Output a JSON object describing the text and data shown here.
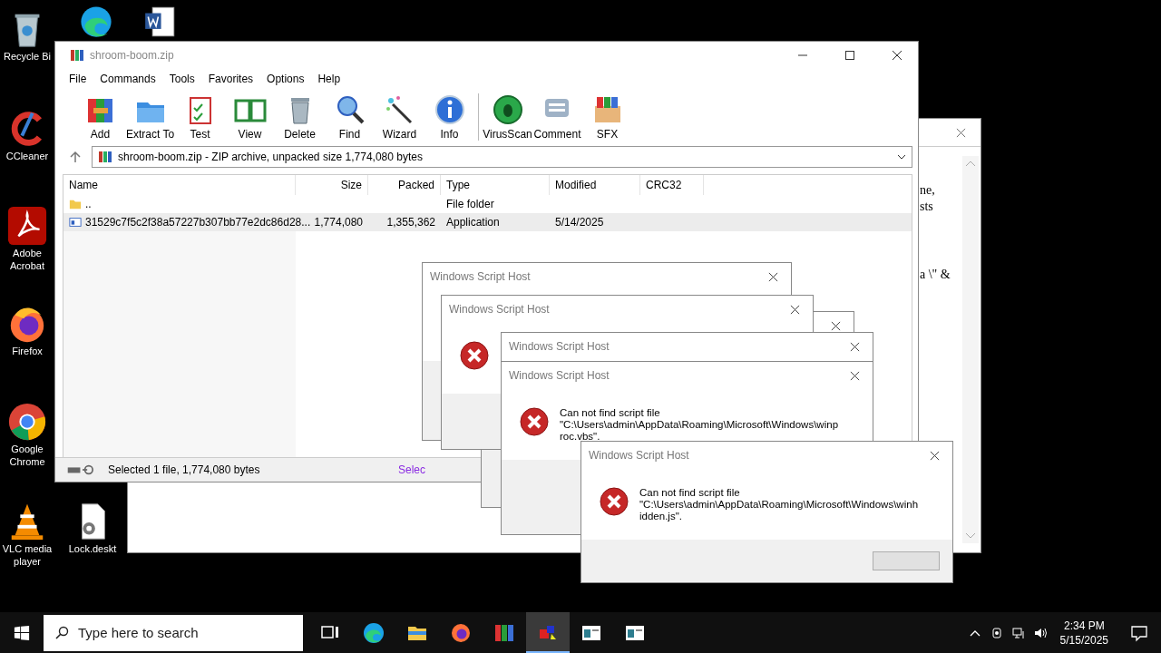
{
  "desktop_icons": [
    {
      "label": "Recycle Bi",
      "kind": "recycle"
    },
    {
      "label": "CCleaner",
      "kind": "ccleaner"
    },
    {
      "label": "Adobe Acrobat",
      "kind": "acrobat"
    },
    {
      "label": "Firefox",
      "kind": "firefox"
    },
    {
      "label": "Google Chrome",
      "kind": "chrome"
    },
    {
      "label": "VLC media player",
      "kind": "vlc"
    },
    {
      "label": "Lock.deskt",
      "kind": "file"
    },
    {
      "kind": "edge"
    },
    {
      "kind": "word"
    }
  ],
  "back_window": {
    "text_fragments": [
      "ne,",
      "sts",
      "a \\\" &"
    ]
  },
  "archiver": {
    "title": "shroom-boom.zip",
    "menu": [
      "File",
      "Commands",
      "Tools",
      "Favorites",
      "Options",
      "Help"
    ],
    "toolbar": [
      {
        "label": "Add",
        "kind": "add"
      },
      {
        "label": "Extract To",
        "kind": "extract"
      },
      {
        "label": "Test",
        "kind": "test"
      },
      {
        "label": "View",
        "kind": "view"
      },
      {
        "label": "Delete",
        "kind": "delete"
      },
      {
        "label": "Find",
        "kind": "find"
      },
      {
        "label": "Wizard",
        "kind": "wizard"
      },
      {
        "label": "Info",
        "kind": "info"
      },
      {
        "label": "VirusScan",
        "kind": "virus"
      },
      {
        "label": "Comment",
        "kind": "comment"
      },
      {
        "label": "SFX",
        "kind": "sfx"
      }
    ],
    "path": "shroom-boom.zip - ZIP archive, unpacked size 1,774,080 bytes",
    "columns": [
      "Name",
      "Size",
      "Packed",
      "Type",
      "Modified",
      "CRC32"
    ],
    "rows": [
      {
        "kind": "folder",
        "name": "..",
        "size": "",
        "packed": "",
        "type": "File folder",
        "modified": "",
        "selected": false
      },
      {
        "kind": "app",
        "name": "31529c7f5c2f38a57227b307bb77e2dc86d28...",
        "size": "1,774,080",
        "packed": "1,355,362",
        "type": "Application",
        "modified": "5/14/2025",
        "selected": true
      }
    ],
    "status": "Selected 1 file, 1,774,080 bytes",
    "status_2": "Selec"
  },
  "dialogs": [
    {
      "kind": "message",
      "title": "Windows Script Host"
    },
    {
      "kind": "message"
    },
    {
      "kind": "message",
      "title": "Windows Script Host",
      "icon": true
    },
    {
      "kind": "message",
      "title": "Windows Script Host"
    },
    {
      "kind": "message",
      "title": "Windows Script Host",
      "icon": true,
      "lines": [
        "Can not find script file",
        "\"C:\\Users\\admin\\AppData\\Roaming\\Microsoft\\Windows\\winp",
        "roc.vbs\"."
      ]
    },
    {
      "kind": "message",
      "title": "Windows Script Host",
      "icon": true,
      "button": true,
      "lines": [
        "Can not find script file",
        "\"C:\\Users\\admin\\AppData\\Roaming\\Microsoft\\Windows\\winh",
        "idden.js\"."
      ]
    }
  ],
  "taskbar": {
    "search_placeholder": "Type here to search",
    "apps": [
      {
        "kind": "taskview",
        "selected": false
      },
      {
        "kind": "edge",
        "selected": false
      },
      {
        "kind": "explorer",
        "selected": false
      },
      {
        "kind": "firefox",
        "selected": false
      },
      {
        "kind": "winrar",
        "selected": false
      },
      {
        "kind": "script",
        "selected": true
      },
      {
        "kind": "window",
        "selected": false
      },
      {
        "kind": "window",
        "selected": false
      }
    ],
    "time": "2:34 PM",
    "date": "5/15/2025"
  }
}
